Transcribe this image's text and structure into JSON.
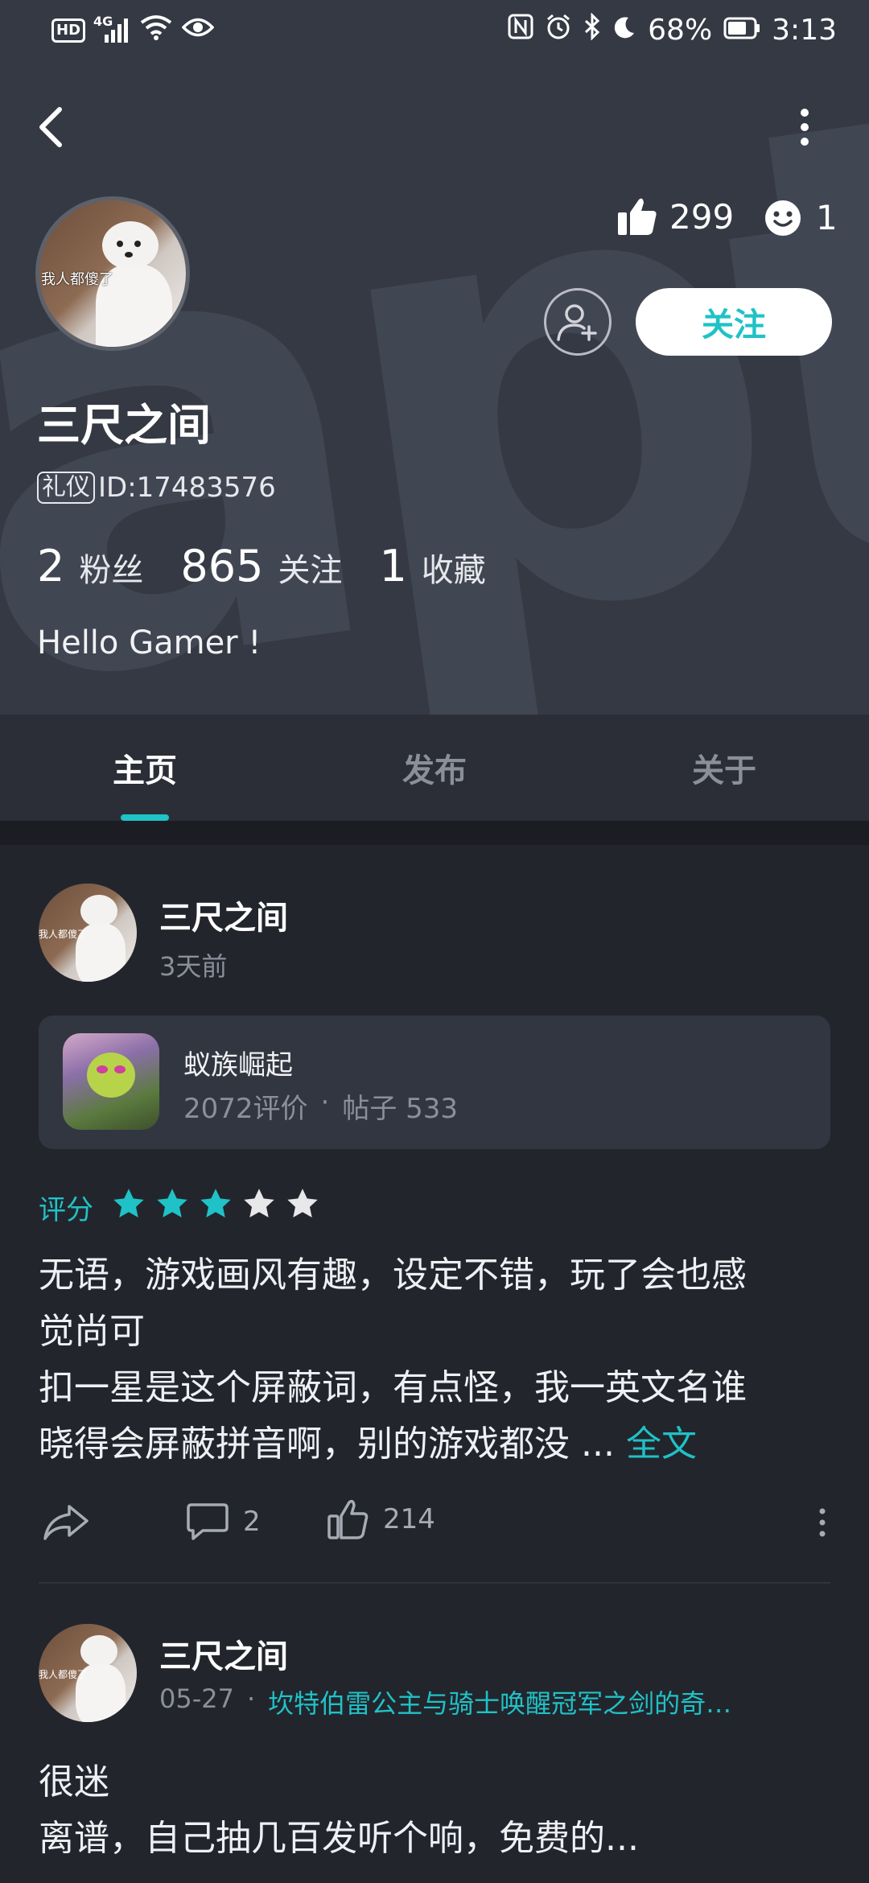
{
  "status_bar": {
    "left_indicators": [
      "HD",
      "4G"
    ],
    "battery": "68%",
    "time": "3:13"
  },
  "watermark_text": "aptar",
  "profile": {
    "avatar_caption": "我人都傻了",
    "name": "三尺之间",
    "badge": "礼仪",
    "id_text": "ID:17483576",
    "likes": "299",
    "emotes": "1",
    "follow_label": "关注",
    "bio": "Hello Gamer !",
    "stats": [
      {
        "num": "2",
        "label": "粉丝"
      },
      {
        "num": "865",
        "label": "关注"
      },
      {
        "num": "1",
        "label": "收藏"
      }
    ]
  },
  "tabs": [
    {
      "label": "主页",
      "selected": true
    },
    {
      "label": "发布",
      "selected": false
    },
    {
      "label": "关于",
      "selected": false
    }
  ],
  "post1": {
    "author": "三尺之间",
    "time": "3天前",
    "game": {
      "name": "蚁族崛起",
      "reviews": "2072评价",
      "dot": "·",
      "posts": "帖子 533"
    },
    "rating_label": "评分",
    "rating": 3,
    "rating_max": 5,
    "lines": [
      "无语，游戏画风有趣，设定不错，玩了会也感",
      "觉尚可",
      "扣一星是这个屏蔽词，有点怪，我一英文名谁",
      "晓得会屏蔽拼音啊，别的游戏都没 ..."
    ],
    "more_label": "全文",
    "comments": "2",
    "likes": "214"
  },
  "post2": {
    "author": "三尺之间",
    "date": "05-27",
    "dot": "·",
    "game_link": "坎特伯雷公主与骑士唤醒冠军之剑的奇…",
    "lines": [
      "很迷",
      "离谱，自己抽几百发听个响，免费的..."
    ]
  },
  "colors": {
    "accent": "#1fc2c6",
    "header_bg": "#353944",
    "page_bg": "#23252d",
    "star_off": "#e8e8ea"
  }
}
